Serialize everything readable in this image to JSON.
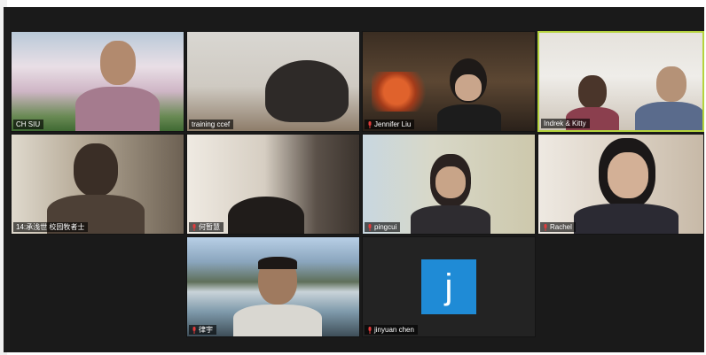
{
  "participants": [
    {
      "name": "CH SIU",
      "muted": false
    },
    {
      "name": "training ccef",
      "muted": false
    },
    {
      "name": "Jennifer Liu",
      "muted": true
    },
    {
      "name": "Indrek & Kitty",
      "muted": false,
      "active_speaker": true
    },
    {
      "name": "14:承浅世 校园牧者士",
      "muted": false
    },
    {
      "name": "何暂慧",
      "muted": true
    },
    {
      "name": "pingcui",
      "muted": true
    },
    {
      "name": "Rachel",
      "muted": true
    },
    {
      "name": "律宇",
      "muted": true
    },
    {
      "name": "jinyuan chen",
      "muted": true,
      "avatar_letter": "j"
    }
  ],
  "colors": {
    "active_border": "#b5d33d",
    "avatar_bg": "#1f8bd6",
    "muted_icon": "#e23b3b"
  }
}
